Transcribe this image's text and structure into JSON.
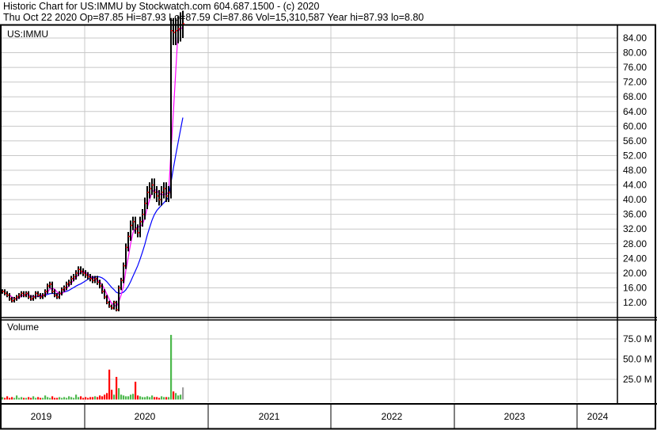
{
  "header": {
    "title": "Historic Chart for US:IMMU by Stockwatch.com 604.687.1500 - (c) 2020",
    "quote": "Thu Oct 22 2020   Op=87.85   Hi=87.93   Lo=87.59   Cl=87.86   Vol=15,310,587   Year hi=87.93   lo=8.80"
  },
  "chart_data": {
    "type": "line",
    "title": "US:IMMU",
    "volume_label": "Volume",
    "price_ticks": [
      "84.00",
      "80.00",
      "76.00",
      "72.00",
      "68.00",
      "64.00",
      "60.00",
      "56.00",
      "52.00",
      "48.00",
      "44.00",
      "40.00",
      "36.00",
      "32.00",
      "28.00",
      "24.00",
      "20.00",
      "16.00",
      "12.00"
    ],
    "volume_ticks": [
      "75.0 M",
      "50.0 M",
      "25.0 M"
    ],
    "x_labels": [
      "2019",
      "2020",
      "2021",
      "2022",
      "2023",
      "2024"
    ],
    "ylim": [
      8.1,
      87.45
    ],
    "volume_ylim": [
      0,
      99
    ],
    "week_closes": [
      15,
      14.5,
      14,
      13,
      12.5,
      13,
      13.5,
      14,
      14.5,
      14,
      14.5,
      13.5,
      13,
      13.5,
      14.5,
      14,
      13.5,
      14,
      15,
      16.5,
      17,
      15,
      14,
      13.5,
      14.5,
      15.5,
      16,
      17,
      17.5,
      18.5,
      19,
      20,
      21,
      20.5,
      20,
      19.5,
      19,
      18.5,
      18,
      18.5,
      17.5,
      16.5,
      15,
      13.5,
      12,
      11,
      10.5,
      12,
      10,
      16,
      18,
      22,
      27,
      30,
      33,
      34,
      32,
      31,
      34,
      36,
      39,
      42,
      43,
      44,
      42,
      41,
      40,
      42,
      43,
      41,
      42,
      86,
      85.5,
      86,
      86.5,
      87.5,
      87.9
    ],
    "week_volumes_m": [
      3,
      2,
      4,
      2,
      3,
      2,
      5,
      2,
      3,
      2,
      2,
      3,
      2,
      4,
      2,
      3,
      2,
      2,
      5,
      3,
      2,
      4,
      2,
      2,
      3,
      2,
      3,
      2,
      4,
      3,
      2,
      6,
      3,
      4,
      2,
      3,
      2,
      3,
      3,
      4,
      3,
      5,
      4,
      6,
      8,
      37,
      12,
      6,
      28,
      14,
      6,
      5,
      4,
      4,
      6,
      7,
      22,
      5,
      4,
      3,
      3,
      4,
      3,
      5,
      3,
      3,
      2,
      4,
      3,
      3,
      3,
      80,
      10,
      8,
      5,
      6,
      15
    ],
    "ma_fast_period": 4,
    "ma_slow_period": 13,
    "colors": {
      "bars": "#000000",
      "close_tick": "#ff0000",
      "ma_fast": "#ff00ff",
      "ma_slow": "#0000ff",
      "vol_up": "#4cb84c",
      "vol_down": "#ff0000",
      "vol_last": "#a0a0a0",
      "grid": "#c8c8c8"
    }
  }
}
